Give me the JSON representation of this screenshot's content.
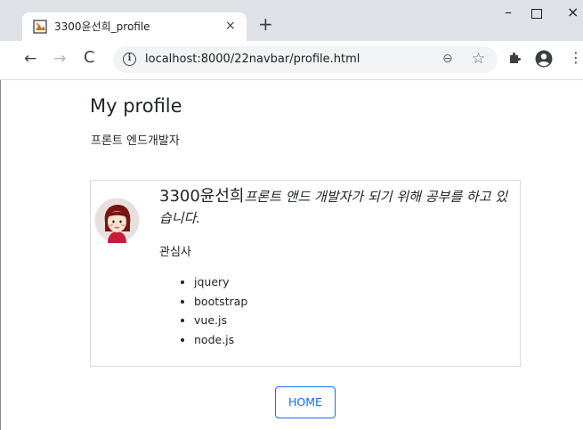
{
  "browser": {
    "tab_title": "3300윤선희_profile",
    "tab_close": "×",
    "new_tab": "+",
    "url": "localhost:8000/22navbar/profile.html",
    "info_glyph": "i",
    "back": "←",
    "forward": "→",
    "reload": "C",
    "window_minimize": "–",
    "window_close": "×",
    "menu": "⋮",
    "zoom_glyph": "⊖",
    "star_glyph": "☆"
  },
  "page": {
    "title": "My profile",
    "subtitle": "프론트 엔드개발자"
  },
  "card": {
    "name": "3300윤선희",
    "description": "프론트 앤드 개발자가 되기 위해 공부를 하고 있습니다.",
    "interest_label": "관심사",
    "interests": [
      "jquery",
      "bootstrap",
      "vue.js",
      "node.js"
    ]
  },
  "home_button": "HOME",
  "colors": {
    "primary": "#0d6efd",
    "tabstrip": "#dee1e6",
    "omnibox": "#f1f3f4"
  }
}
